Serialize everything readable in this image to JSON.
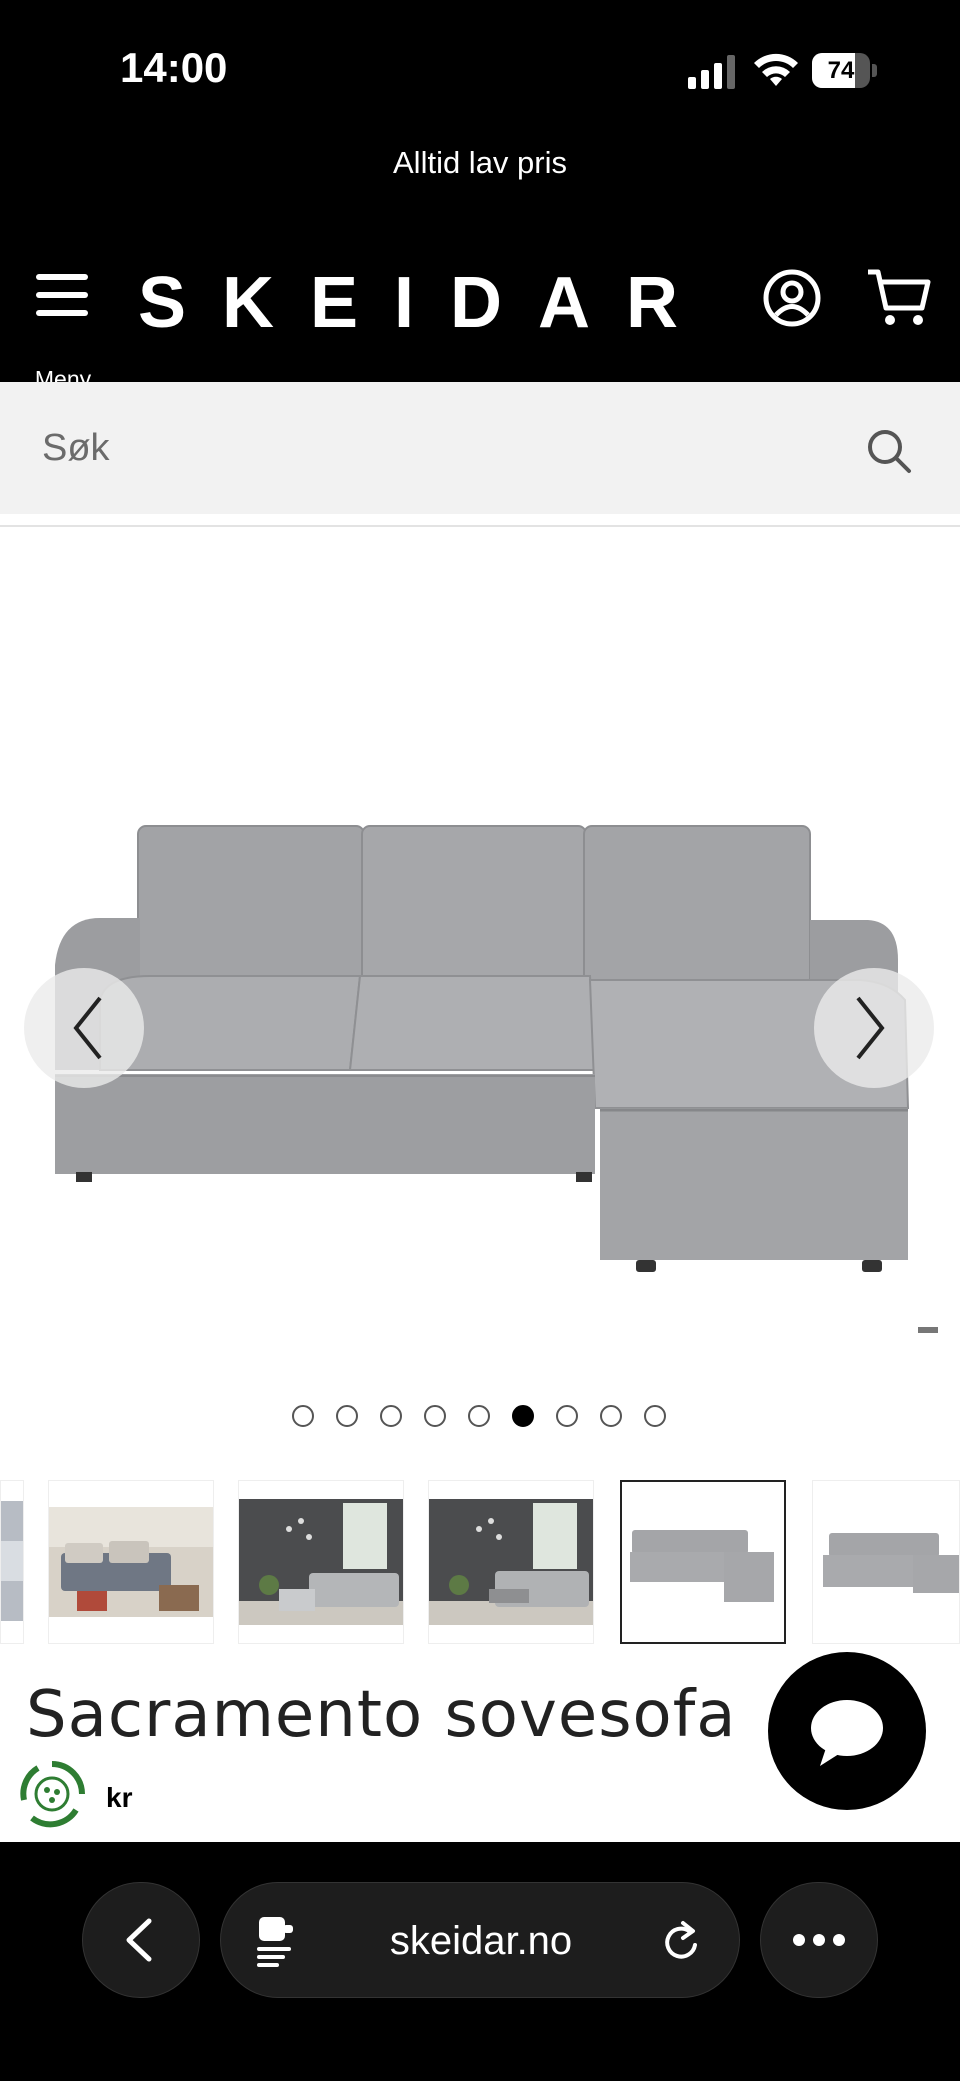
{
  "status_bar": {
    "time": "14:00",
    "battery": "74",
    "battery_level": 0.74
  },
  "promo_banner": {
    "text": "Alltid lav pris"
  },
  "header": {
    "menu_label": "Meny",
    "logo": "SKEIDAR"
  },
  "search": {
    "placeholder": "Søk",
    "value": ""
  },
  "gallery": {
    "image_count": 9,
    "active_index": 5
  },
  "thumbnails": [
    {
      "name": "thumb-1",
      "active": false
    },
    {
      "name": "thumb-2",
      "active": false
    },
    {
      "name": "thumb-3",
      "active": false
    },
    {
      "name": "thumb-4",
      "active": false
    },
    {
      "name": "thumb-5",
      "active": true
    },
    {
      "name": "thumb-6",
      "active": false
    }
  ],
  "product": {
    "title": "Sacramento sovesofa",
    "price": "kr"
  },
  "browser": {
    "url": "skeidar.no"
  },
  "colors": {
    "topbar": "#000000",
    "search_bg": "#f2f2f2",
    "sofa": "#a7a8ab",
    "eco_green": "#2e7d32"
  }
}
